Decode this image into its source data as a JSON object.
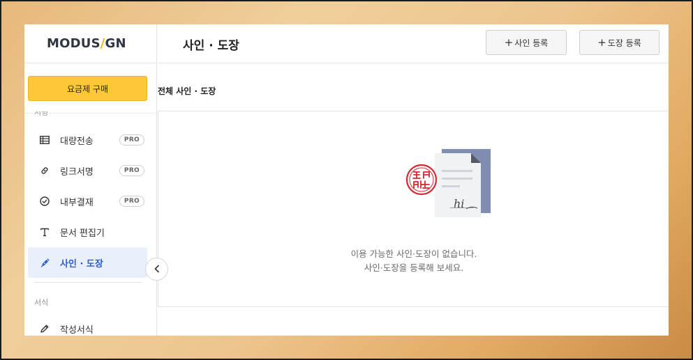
{
  "sidebar": {
    "logo_left": "MODUS",
    "logo_slash": "/",
    "logo_right": "GN",
    "plan_button": "요금제 구매",
    "section_cut_label": "서명",
    "items": [
      {
        "label": "대량전송",
        "icon": "table-icon",
        "badge": "PRO"
      },
      {
        "label": "링크서명",
        "icon": "link-icon",
        "badge": "PRO"
      },
      {
        "label": "내부결재",
        "icon": "check-circle-icon",
        "badge": "PRO"
      },
      {
        "label": "문서 편집기",
        "icon": "text-t-icon"
      },
      {
        "label": "사인 · 도장",
        "icon": "pen-icon",
        "active": true
      }
    ],
    "section2_label": "서식",
    "items2": [
      {
        "label": "작성서식",
        "icon": "pencil-icon"
      }
    ]
  },
  "header": {
    "title": "사인 · 도장",
    "add_sign_plus": "+",
    "add_sign": "사인 등록",
    "add_seal_plus": "+",
    "add_seal": "도장 등록"
  },
  "content": {
    "subhead": "전체 사인 · 도장",
    "empty_line1": "이용 가능한 사인·도장이 없습니다.",
    "empty_line2": "사인·도장을 등록해 보세요.",
    "signature_text": "hi"
  },
  "colors": {
    "accent_yellow": "#fcc83a",
    "active_blue": "#2a5bd7",
    "active_bg": "#e9f0fb",
    "seal_red": "#d8262e",
    "doc_blue": "#7e8db0"
  }
}
